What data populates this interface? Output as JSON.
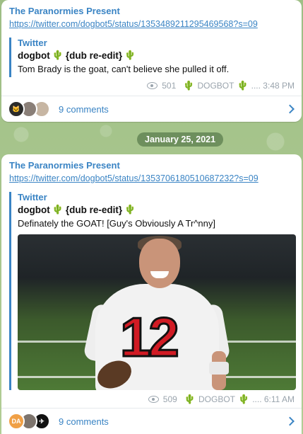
{
  "date_divider": "January 25, 2021",
  "posts": [
    {
      "channel": "The Paranormies Present",
      "link": "https://twitter.com/dogbot5/status/1353489211295469568?s=09",
      "quote": {
        "source": "Twitter",
        "author": "dogbot",
        "author_suffix": "{dub re-edit}",
        "text": "Tom Brady is the goat, can't believe she pulled it off."
      },
      "views": "501",
      "signature": "DOGBOT",
      "time": ".... 3:48 PM",
      "comments": "9 comments",
      "avatars": [
        "cat-avatar",
        "person-avatar",
        "person-avatar"
      ]
    },
    {
      "channel": "The Paranormies Present",
      "link": "https://twitter.com/dogbot5/status/1353706180510687232?s=09",
      "quote": {
        "source": "Twitter",
        "author": "dogbot",
        "author_suffix": "{dub re-edit}",
        "text": "Definately the GOAT! [Guy's Obviously A Tr^nny]"
      },
      "photo_jersey_number": "12",
      "views": "509",
      "signature": "DOGBOT",
      "time": ".... 6:11 AM",
      "comments": "9 comments",
      "avatar_initials": "DA"
    }
  ],
  "colors": {
    "accent": "#3a84c4",
    "cactus": "#3f9e2e",
    "meta": "#9aa4ad"
  }
}
